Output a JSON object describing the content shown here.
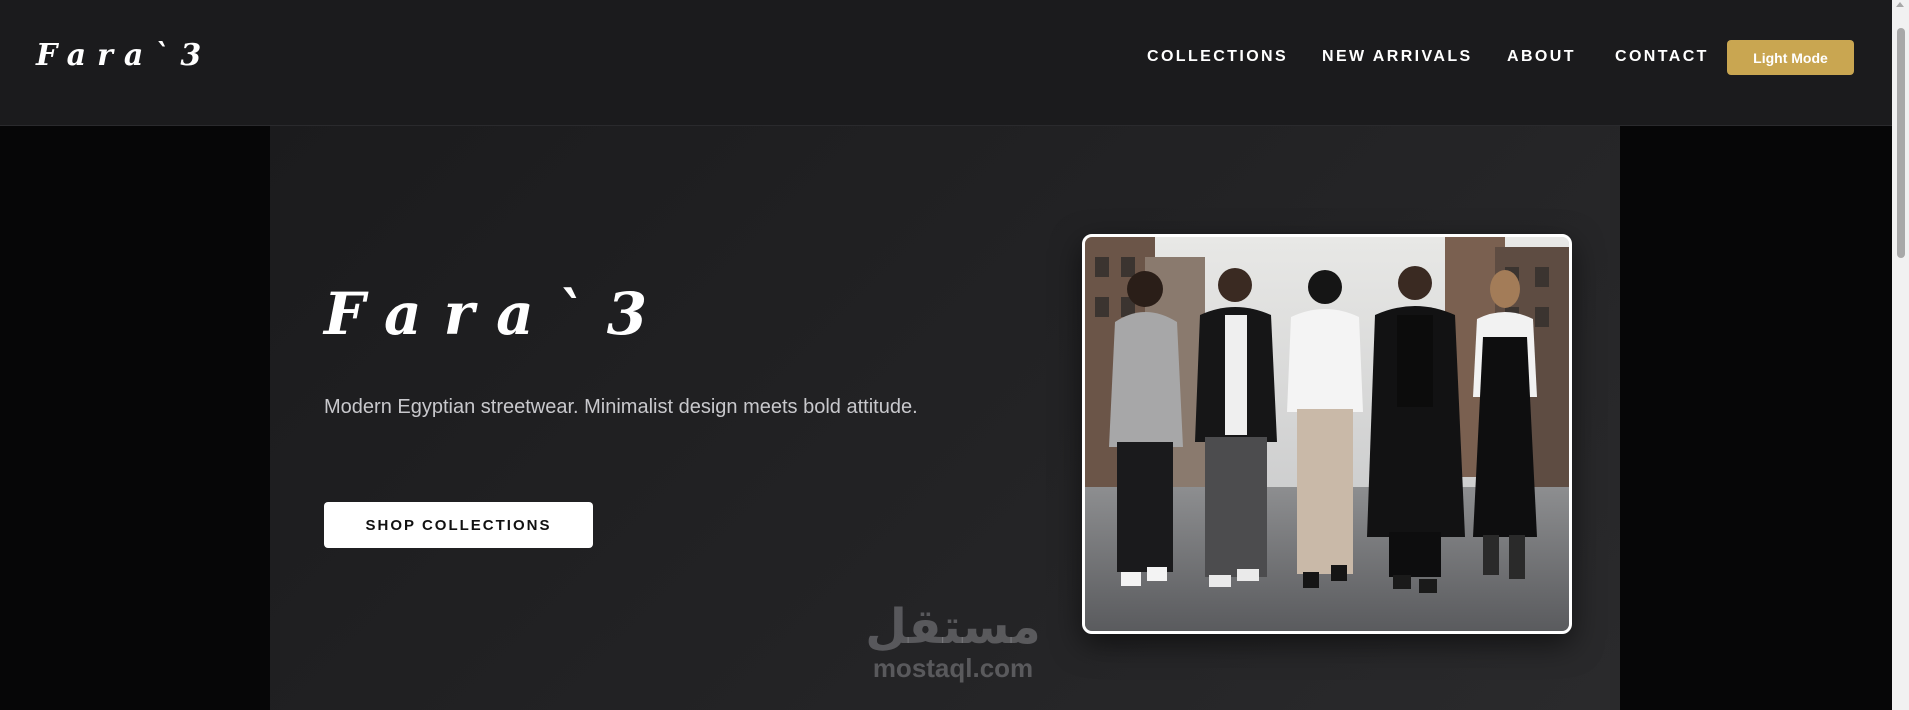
{
  "brand": "Fara`3",
  "nav": {
    "items": [
      "COLLECTIONS",
      "NEW ARRIVALS",
      "ABOUT",
      "CONTACT"
    ],
    "mode_toggle": "Light Mode"
  },
  "hero": {
    "title": "Fara`3",
    "description": "Modern Egyptian streetwear. Minimalist design meets bold attitude.",
    "cta": "SHOP COLLECTIONS",
    "image_alt": "Five models walking in streetwear on a city street"
  },
  "watermark": {
    "arabic": "مستقل",
    "latin": "mostaql.com"
  },
  "colors": {
    "accent": "#c9a651",
    "nav_bg": "#1b1b1d",
    "hero_bg": "#232325",
    "page_bg": "#060607"
  }
}
